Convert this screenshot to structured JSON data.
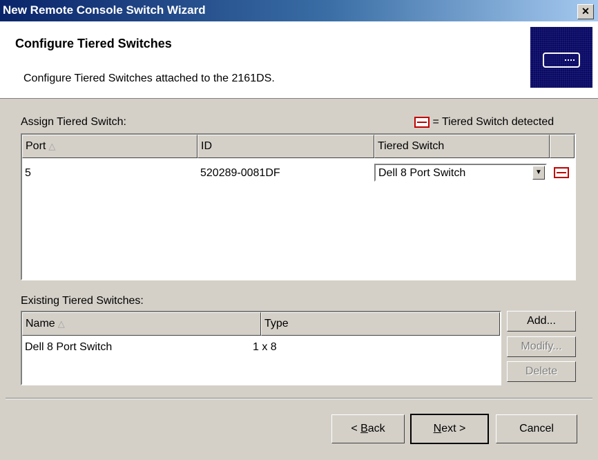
{
  "window": {
    "title": "New Remote Console Switch Wizard",
    "close_glyph": "✕"
  },
  "header": {
    "title": "Configure Tiered Switches",
    "subtitle": "Configure Tiered Switches attached to the 2161DS.",
    "icon": "switch-device-icon"
  },
  "assign": {
    "label": "Assign Tiered Switch:",
    "legend": "= Tiered Switch detected",
    "legend_icon": "tiered-switch-detected-icon",
    "columns": [
      "Port",
      "ID",
      "Tiered Switch",
      ""
    ],
    "rows": [
      {
        "port": "5",
        "id": "520289-0081DF",
        "tiered_switch": "Dell 8 Port Switch",
        "detected": true
      }
    ]
  },
  "existing": {
    "label": "Existing Tiered Switches:",
    "columns": [
      "Name",
      "Type"
    ],
    "rows": [
      {
        "name": "Dell 8 Port Switch",
        "type": "1 x 8"
      }
    ],
    "buttons": {
      "add": "Add...",
      "modify": "Modify...",
      "delete": "Delete"
    }
  },
  "footer": {
    "back_pre": "< ",
    "back_key": "B",
    "back_post": "ack",
    "next_key": "N",
    "next_post": "ext >",
    "cancel": "Cancel"
  },
  "sort_glyph": "△",
  "colors": {
    "title_start": "#0a246a",
    "title_end": "#a6caf0",
    "face": "#d4d0c8",
    "detected": "#c00000"
  }
}
